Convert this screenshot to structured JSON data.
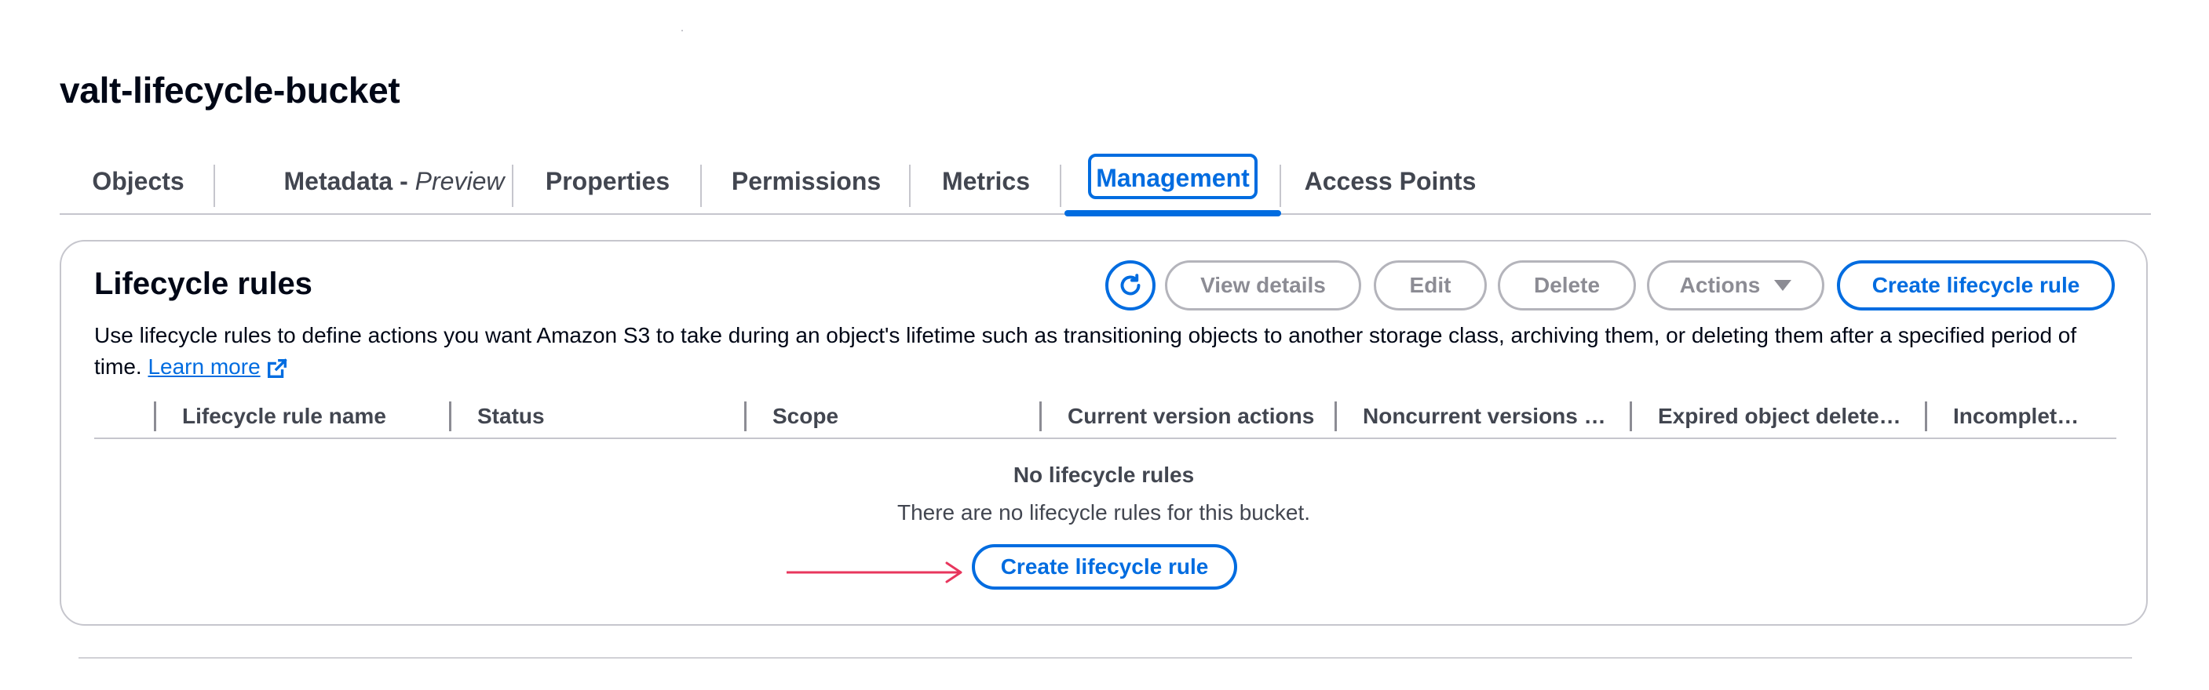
{
  "bucket": {
    "title": "valt-lifecycle-bucket"
  },
  "tabs": [
    {
      "label": "Objects"
    },
    {
      "label": "Metadata - ",
      "italic": "Preview"
    },
    {
      "label": "Properties"
    },
    {
      "label": "Permissions"
    },
    {
      "label": "Metrics"
    },
    {
      "label": "Management",
      "active": true
    },
    {
      "label": "Access Points"
    }
  ],
  "lifecycle": {
    "title": "Lifecycle rules",
    "buttons": {
      "view_details": "View details",
      "edit": "Edit",
      "delete": "Delete",
      "actions": "Actions",
      "create": "Create lifecycle rule"
    },
    "description": "Use lifecycle rules to define actions you want Amazon S3 to take during an object's lifetime such as transitioning objects to another storage class, archiving them, or deleting them after a specified period of time.",
    "learn_more": "Learn more",
    "columns": [
      "Lifecycle rule name",
      "Status",
      "Scope",
      "Current version actions",
      "Noncurrent versions …",
      "Expired object delete…",
      "Incomplet…"
    ],
    "empty": {
      "title": "No lifecycle rules",
      "description": "There are no lifecycle rules for this bucket.",
      "create": "Create lifecycle rule"
    }
  },
  "colors": {
    "accent": "#006ce0",
    "annotation_arrow": "#e8365d",
    "text": "#000716",
    "muted": "#424650",
    "disabled": "#8c8c94",
    "border": "#c6c6cd"
  },
  "icons": [
    "refresh-icon",
    "external-link-icon",
    "caret-down-icon",
    "annotation-arrow"
  ]
}
